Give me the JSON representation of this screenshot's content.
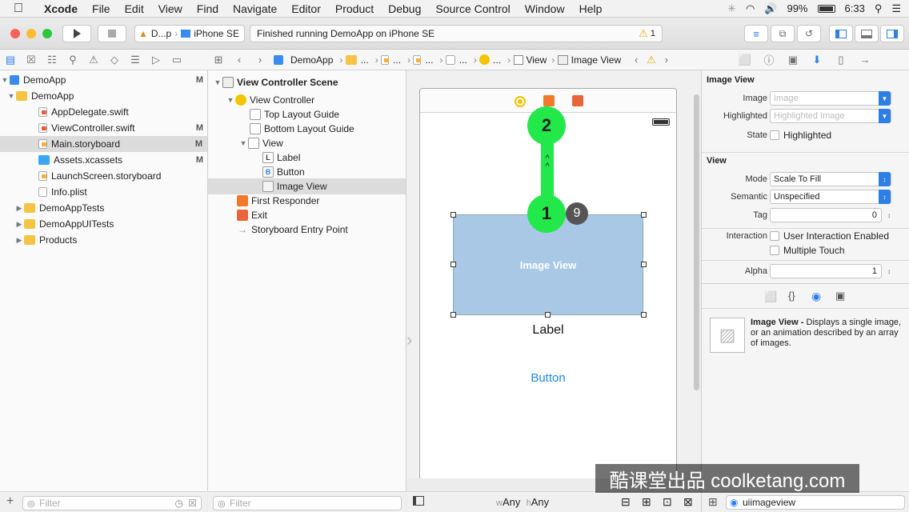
{
  "menubar": {
    "app": "Xcode",
    "items": [
      "File",
      "Edit",
      "View",
      "Find",
      "Navigate",
      "Editor",
      "Product",
      "Debug",
      "Source Control",
      "Window",
      "Help"
    ],
    "battery": "99%",
    "time": "6:33"
  },
  "toolbar": {
    "scheme": "D...p",
    "device": "iPhone SE",
    "status": "Finished running DemoApp on iPhone SE",
    "warnings": "1"
  },
  "jumpbar": {
    "project": "DemoApp",
    "ellipsis": "...",
    "view": "View",
    "selected": "Image View"
  },
  "navigator": {
    "items": [
      {
        "label": "DemoApp",
        "flag": "M"
      },
      {
        "label": "DemoApp",
        "flag": ""
      },
      {
        "label": "AppDelegate.swift",
        "flag": ""
      },
      {
        "label": "ViewController.swift",
        "flag": "M"
      },
      {
        "label": "Main.storyboard",
        "flag": "M"
      },
      {
        "label": "Assets.xcassets",
        "flag": "M"
      },
      {
        "label": "LaunchScreen.storyboard",
        "flag": ""
      },
      {
        "label": "Info.plist",
        "flag": ""
      },
      {
        "label": "DemoAppTests",
        "flag": ""
      },
      {
        "label": "DemoAppUITests",
        "flag": ""
      },
      {
        "label": "Products",
        "flag": ""
      }
    ],
    "filter_placeholder": "Filter"
  },
  "outline": {
    "scene": "View Controller Scene",
    "items": [
      "View Controller",
      "Top Layout Guide",
      "Bottom Layout Guide",
      "View",
      "Label",
      "Button",
      "Image View",
      "First Responder",
      "Exit",
      "Storyboard Entry Point"
    ],
    "filter_placeholder": "Filter"
  },
  "canvas": {
    "image_view_label": "Image View",
    "label_text": "Label",
    "button_text": "Button",
    "marker_top": "2",
    "marker_bottom": "1",
    "marker_count": "9",
    "arrow_text": "^\n^",
    "size_w": "Any",
    "size_h": "Any",
    "w_prefix": "w",
    "h_prefix": "h"
  },
  "inspector": {
    "image_view_header": "Image View",
    "image_label": "Image",
    "image_placeholder": "Image",
    "highlighted_label": "Highlighted",
    "highlighted_placeholder": "Highlighted Image",
    "state_label": "State",
    "state_option": "Highlighted",
    "view_header": "View",
    "mode_label": "Mode",
    "mode_value": "Scale To Fill",
    "semantic_label": "Semantic",
    "semantic_value": "Unspecified",
    "tag_label": "Tag",
    "tag_value": "0",
    "interaction_label": "Interaction",
    "interaction_opt1": "User Interaction Enabled",
    "interaction_opt2": "Multiple Touch",
    "alpha_label": "Alpha",
    "alpha_value": "1",
    "library_title": "Image View -",
    "library_desc": "Displays a single image, or an animation described by an array of images.",
    "search_value": "uiimageview"
  },
  "watermark": "酷课堂出品 coolketang.com"
}
